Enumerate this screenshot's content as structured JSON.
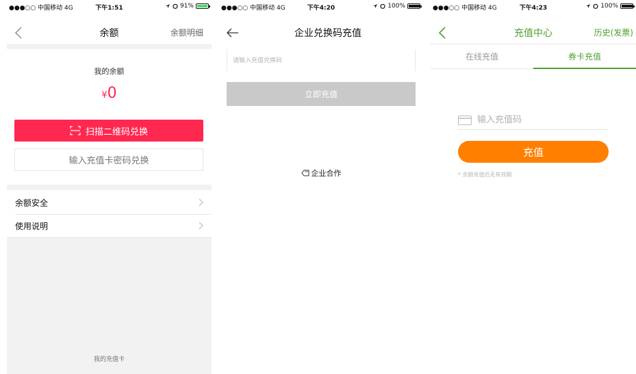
{
  "screens": [
    {
      "status": {
        "carrier": "●●●○○ 中国移动  4G",
        "time": "下午1:51",
        "battery": "91%"
      },
      "nav": {
        "title": "余额",
        "right": "余额明细"
      },
      "balance_label": "我的余额",
      "currency": "¥",
      "amount": "0",
      "scan_button": "扫描二维码兑换",
      "card_button": "输入充值卡密码兑换",
      "menu": [
        {
          "label": "余额安全"
        },
        {
          "label": "使用说明"
        }
      ],
      "my_card": "我的充值卡"
    },
    {
      "status": {
        "carrier": "●●●○○ 中国移动  4G",
        "time": "下午4:20",
        "battery": "100%"
      },
      "nav": {
        "title": "企业兑换码充值"
      },
      "input_placeholder": "请输入充值兑换码",
      "button": "立即充值",
      "cooperation": "企业合作"
    },
    {
      "status": {
        "carrier": "●●●○○ 中国移动  4G",
        "time": "下午4:23",
        "battery": "100%"
      },
      "nav": {
        "title": "充值中心",
        "right": "历史(发票)"
      },
      "tabs": [
        {
          "label": "在线充值"
        },
        {
          "label": "券卡充值"
        }
      ],
      "input_placeholder": "输入充值码",
      "button": "充值",
      "note": "* 余额充值后无有效期"
    }
  ],
  "colors": {
    "primary_red": "#ff2851",
    "accent_green": "#4ea12e",
    "accent_orange": "#ff7f00",
    "disabled_gray": "#c9c9c9"
  },
  "icons": [
    "back-chevron-icon",
    "back-arrow-icon",
    "scan-icon",
    "chevron-right-icon",
    "diamond-tag-icon",
    "card-icon",
    "location-icon",
    "alarm-icon"
  ]
}
